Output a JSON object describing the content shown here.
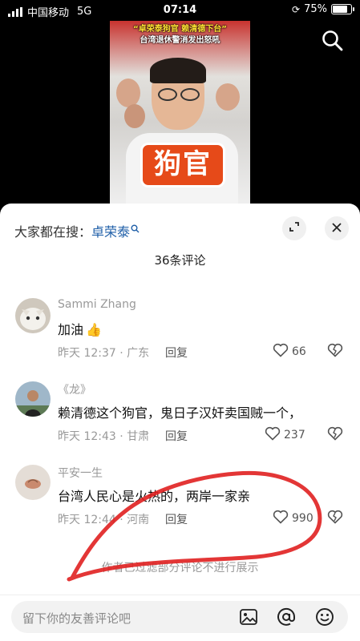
{
  "status": {
    "carrier": "中国移动",
    "network": "5G",
    "time": "07:14",
    "battery": "75%",
    "battery_level": 0.75
  },
  "video": {
    "caption_line1": "“卓荣泰狗官 赖清德下台”",
    "caption_line2": "台湾退休警消发出怒吼",
    "sticker": "狗官"
  },
  "sheet": {
    "hot_search_prefix": "大家都在搜：",
    "hot_search_keyword": "卓荣泰",
    "comment_count": "36条评论",
    "filtered_notice": "作者已过滤部分评论不进行展示",
    "input_placeholder": "留下你的友善评论吧"
  },
  "comments": [
    {
      "name": "Sammi Zhang",
      "text": "加油",
      "meta": "昨天 12:37 · 广东",
      "reply": "回复",
      "likes": "66"
    },
    {
      "name": "《龙》",
      "text": "赖清德这个狗官，鬼日子汉奸卖国贼一个，",
      "meta": "昨天 12:43 · 甘肃",
      "reply": "回复",
      "likes": "237"
    },
    {
      "name": "平安一生",
      "text": "台湾人民心是火热的，两岸一家亲",
      "meta": "昨天 12:44 · 河南",
      "reply": "回复",
      "likes": "990"
    }
  ],
  "icons": [
    "signal-icon",
    "battery-icon",
    "search-icon",
    "expand-icon",
    "close-icon",
    "heart-icon",
    "heart-broken-icon",
    "image-icon",
    "at-icon",
    "emoji-icon"
  ]
}
